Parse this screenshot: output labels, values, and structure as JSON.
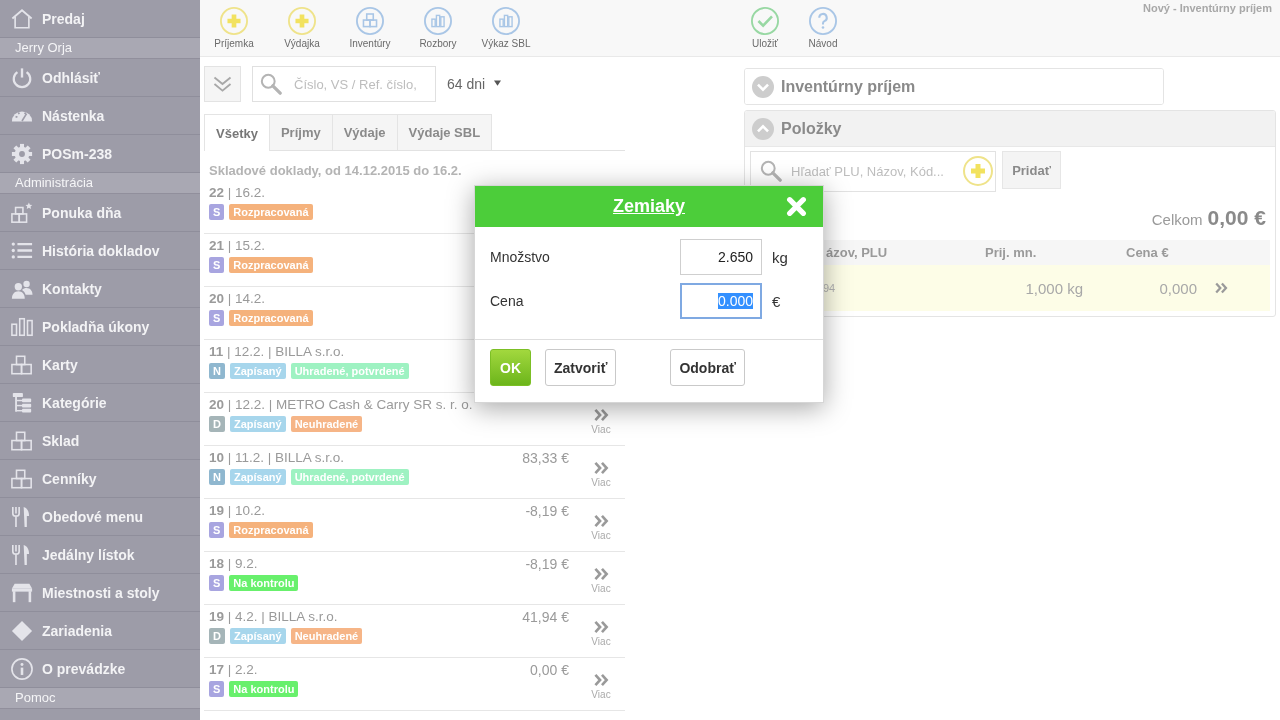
{
  "sidebar": {
    "groups": [
      {
        "items": [
          {
            "label": "Predaj",
            "kind": "home"
          }
        ]
      },
      {
        "title": "Jerry Orja",
        "items": [
          {
            "label": "Odhlásiť",
            "kind": "power"
          },
          {
            "label": "Nástenka",
            "kind": "gauge"
          },
          {
            "label": "POSm-238",
            "kind": "gear"
          }
        ]
      },
      {
        "title": "Administrácia",
        "items": [
          {
            "label": "Ponuka dňa",
            "kind": "featured"
          },
          {
            "label": "História dokladov",
            "kind": "list"
          },
          {
            "label": "Kontakty",
            "kind": "people"
          },
          {
            "label": "Pokladňa úkony",
            "kind": "bars"
          },
          {
            "label": "Karty",
            "kind": "boxes"
          },
          {
            "label": "Kategórie",
            "kind": "tree"
          },
          {
            "label": "Sklad",
            "kind": "boxes"
          },
          {
            "label": "Cenníky",
            "kind": "boxes"
          },
          {
            "label": "Obedové menu",
            "kind": "cutlery"
          },
          {
            "label": "Jedálny lístok",
            "kind": "cutlery"
          },
          {
            "label": "Miestnosti a stoly",
            "kind": "table"
          },
          {
            "label": "Zariadenia",
            "kind": "diamond"
          },
          {
            "label": "O prevádzke",
            "kind": "info"
          }
        ]
      },
      {
        "title": "Pomoc"
      }
    ]
  },
  "toolbar": {
    "buttons": [
      {
        "label": "Príjemka",
        "kind": "add"
      },
      {
        "label": "Výdajka",
        "kind": "add"
      },
      {
        "label": "Inventúry",
        "kind": "boxes"
      },
      {
        "label": "Rozbory",
        "kind": "chart"
      },
      {
        "label": "Výkaz SBL",
        "kind": "chart"
      }
    ]
  },
  "filter": {
    "search": {
      "placeholder": "Číslo, VS / Ref. číslo,"
    },
    "period": "64 dni"
  },
  "tabs": [
    {
      "label": "Všetky",
      "selected": true
    },
    {
      "label": "Príjmy",
      "selected": false
    },
    {
      "label": "Výdaje",
      "selected": false
    },
    {
      "label": "Výdaje SBL",
      "selected": false
    }
  ],
  "documents": {
    "heading": "Skladové doklady, od 14.12.2015 do 16.2.",
    "rows": [
      {
        "title": "**22** | 16.2.",
        "badges": [
          {
            "label": "S",
            "color": "#a8a5e0"
          },
          {
            "label": "Rozpracovaná",
            "color": "#f5b27c"
          }
        ]
      },
      {
        "title": "**21** | 15.2.",
        "badges": [
          {
            "label": "S",
            "color": "#a8a5e0"
          },
          {
            "label": "Rozpracovaná",
            "color": "#f5b27c"
          }
        ]
      },
      {
        "title": "**20** | 14.2.",
        "badges": [
          {
            "label": "S",
            "color": "#a8a5e0"
          },
          {
            "label": "Rozpracovaná",
            "color": "#f5b27c"
          }
        ]
      },
      {
        "title": "**11** | 12.2. | BILLA s.r.o.",
        "badges": [
          {
            "label": "N",
            "color": "#8fb7cf"
          },
          {
            "label": "Zapísaný",
            "color": "#a7d6ec"
          },
          {
            "label": "Uhradené, potvrdené",
            "color": "#9ef2c2"
          }
        ]
      },
      {
        "title": "**20** | 12.2. | METRO Cash & Carry SR s. r. o.",
        "badges": [
          {
            "label": "D",
            "color": "#a5b5b8"
          },
          {
            "label": "Zapísaný",
            "color": "#a7d6ec"
          },
          {
            "label": "Neuhradené",
            "color": "#f6b587"
          }
        ],
        "more": "Viac"
      },
      {
        "title": "**10** | 11.2. | BILLA s.r.o.",
        "badges": [
          {
            "label": "N",
            "color": "#8fb7cf"
          },
          {
            "label": "Zapísaný",
            "color": "#a7d6ec"
          },
          {
            "label": "Uhradené, potvrdené",
            "color": "#9ef2c2"
          }
        ],
        "amount": "83,33 €",
        "more": "Viac"
      },
      {
        "title": "**19** | 10.2.",
        "badges": [
          {
            "label": "S",
            "color": "#a8a5e0"
          },
          {
            "label": "Rozpracovaná",
            "color": "#f5b27c"
          }
        ],
        "amount": "-8,19 €",
        "more": "Viac"
      },
      {
        "title": "**18** | 9.2.",
        "badges": [
          {
            "label": "S",
            "color": "#a8a5e0"
          },
          {
            "label": "Na kontrolu",
            "color": "#68f06c"
          }
        ],
        "amount": "-8,19 €",
        "more": "Viac"
      },
      {
        "title": "**19** | 4.2. | BILLA s.r.o.",
        "badges": [
          {
            "label": "D",
            "color": "#a5b5b8"
          },
          {
            "label": "Zapísaný",
            "color": "#a7d6ec"
          },
          {
            "label": "Neuhradené",
            "color": "#f6b587"
          }
        ],
        "amount": "41,94 €",
        "more": "Viac"
      },
      {
        "title": "**17** | 2.2.",
        "badges": [
          {
            "label": "S",
            "color": "#a8a5e0"
          },
          {
            "label": "Na kontrolu",
            "color": "#68f06c"
          }
        ],
        "amount": "0,00 €",
        "more": "Viac"
      }
    ]
  },
  "editor": {
    "toolbar": {
      "buttons": [
        {
          "label": "Uložiť",
          "kind": "check"
        },
        {
          "label": "Návod",
          "kind": "help"
        }
      ]
    },
    "title": "Nový - Inventúrny príjem",
    "sections": [
      {
        "title": "Inventúrny príjem",
        "expanded": false
      },
      {
        "title": "Položky",
        "expanded": true,
        "search": {
          "placeholder": "Hľadať PLU, Názov, Kód..."
        },
        "add_button": "Pridať",
        "total_label": "Celkom",
        "total": "0,00 €",
        "columns": [
          "ázov, PLU",
          "Prij. mn.",
          "Cena €"
        ],
        "rows": [
          {
            "cells": [
              "94",
              "1,000 kg",
              "0,000"
            ]
          }
        ]
      }
    ]
  },
  "modal": {
    "title": "Zemiaky",
    "fields": [
      {
        "label": "Množstvo",
        "value": "2.650",
        "unit": "kg",
        "focused": false,
        "text_selected": false
      },
      {
        "label": "Cena",
        "value": "0.000",
        "unit": "€",
        "focused": true,
        "text_selected": true
      }
    ],
    "buttons": [
      {
        "label": "OK",
        "kind": "confirm"
      },
      {
        "label": "Zatvoriť",
        "kind": "close"
      },
      {
        "label": "Odobrať",
        "kind": "remove"
      }
    ]
  }
}
